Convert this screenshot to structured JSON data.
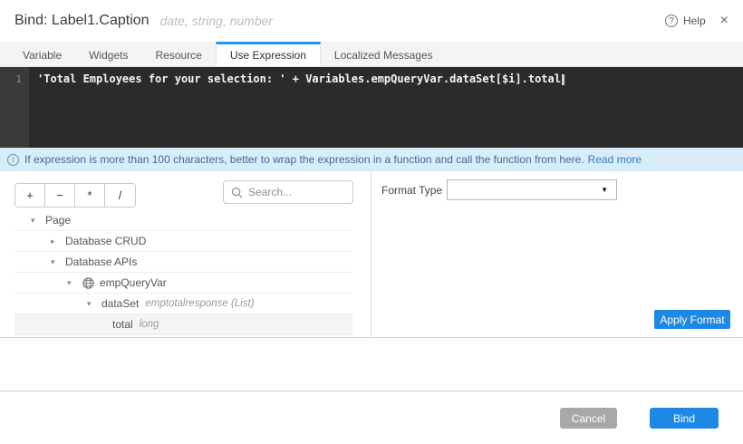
{
  "colors": {
    "accent_blue": "#1e88e5",
    "tab_active_border": "#2196f3",
    "cancel_gray": "#a8a8a8",
    "editor_background": "#2b2b2b",
    "info_bar_background": "#d9ecf9",
    "selected_row_background": "#f4f4f4"
  },
  "header": {
    "title": "Bind: Label1.Caption",
    "hint": "date, string, number",
    "help_label": "Help",
    "help_icon": "?",
    "close_icon": "×"
  },
  "tabs": {
    "active": "Use Expression",
    "items": [
      {
        "label": "Variable"
      },
      {
        "label": "Widgets"
      },
      {
        "label": "Resource"
      },
      {
        "label": "Use Expression"
      },
      {
        "label": "Localized Messages"
      }
    ]
  },
  "editor": {
    "line_number": "1",
    "code": "'Total Employees for your selection: ' + Variables.empQueryVar.dataSet[$i].total"
  },
  "info_bar": {
    "icon": "i",
    "message": "If expression is more than 100 characters, better to wrap the expression in a function and call the function from here.",
    "link_text": "Read more"
  },
  "operators": {
    "items": [
      "+",
      "−",
      "*",
      "/"
    ]
  },
  "search": {
    "placeholder": "Search..."
  },
  "tree": {
    "rows": [
      {
        "label": "Page",
        "arrow": "▾",
        "level": 0
      },
      {
        "label": "Database CRUD",
        "arrow": "▸",
        "level": 1
      },
      {
        "label": "Database APIs",
        "arrow": "▾",
        "level": 1
      },
      {
        "label": "empQueryVar",
        "arrow": "▾",
        "level": 2,
        "icon": "service-variable"
      },
      {
        "label": "dataSet",
        "type": "emptotalresponse (List)",
        "arrow": "▾",
        "level": 3
      },
      {
        "label": "total",
        "type": "long",
        "level": 4,
        "selected": true
      }
    ]
  },
  "format_panel": {
    "label": "Format Type",
    "selected_value": "",
    "dropdown_arrow": "▼",
    "apply_button": "Apply Format"
  },
  "footer": {
    "cancel_label": "Cancel",
    "bind_label": "Bind"
  }
}
